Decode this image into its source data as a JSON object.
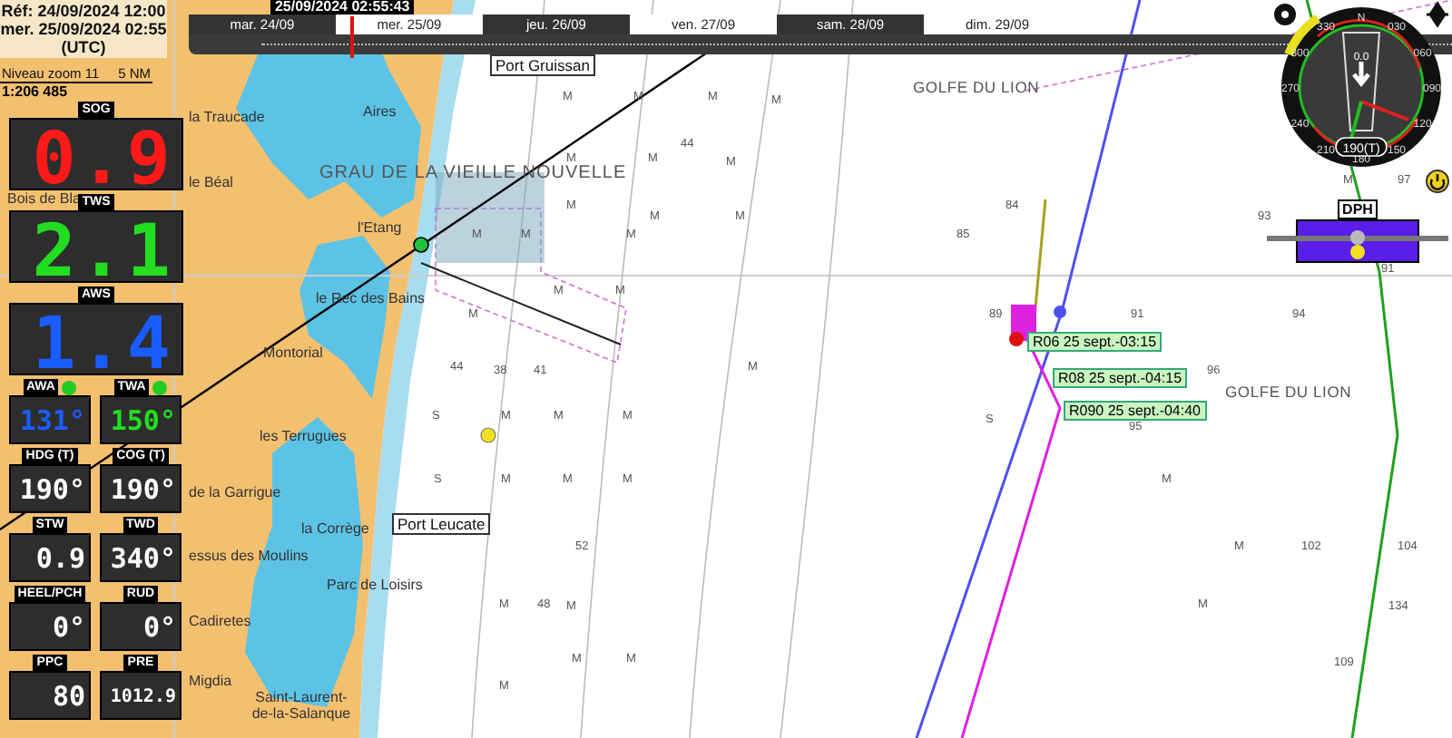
{
  "info": {
    "reference": "Réf: 24/09/2024 12:00",
    "current": "mer. 25/09/2024 02:55",
    "timezone": "(UTC)"
  },
  "scale": {
    "zoom_label": "Niveau zoom 11",
    "distance": "5 NM",
    "ratio": "1:206 485"
  },
  "timeline": {
    "cursor_label": "25/09/2024 02:55:43",
    "level": 0.13,
    "days": [
      "mar. 24/09",
      "mer. 25/09",
      "jeu. 26/09",
      "ven. 27/09",
      "sam. 28/09",
      "dim. 29/09"
    ]
  },
  "instruments": [
    {
      "kind": "large",
      "label": "SOG",
      "value": "0.9",
      "color": "#ff1a1a",
      "status_light": false
    },
    {
      "kind": "large",
      "label": "TWS",
      "value": "2.1",
      "color": "#22dd22",
      "status_light": false
    },
    {
      "kind": "large",
      "label": "AWS",
      "value": "1.4",
      "color": "#1a5cff",
      "status_light": false
    },
    {
      "kind": "small",
      "label": "AWA",
      "value": "131°",
      "color": "#1a5cff",
      "status_light": true
    },
    {
      "kind": "small",
      "label": "TWA",
      "value": "150°",
      "color": "#22dd22",
      "status_light": true
    },
    {
      "kind": "small",
      "label": "HDG (T)",
      "value": "190°",
      "color": "#ffffff",
      "status_light": false
    },
    {
      "kind": "small",
      "label": "COG (T)",
      "value": "190°",
      "color": "#ffffff",
      "status_light": false
    },
    {
      "kind": "small",
      "label": "STW",
      "value": "0.9",
      "color": "#ffffff",
      "status_light": false
    },
    {
      "kind": "small",
      "label": "TWD",
      "value": "340°",
      "color": "#ffffff",
      "status_light": false
    },
    {
      "kind": "small",
      "label": "HEEL/PCH",
      "value": "0°",
      "color": "#ffffff",
      "status_light": false
    },
    {
      "kind": "small",
      "label": "RUD",
      "value": "0°",
      "color": "#ffffff",
      "status_light": false
    },
    {
      "kind": "small",
      "label": "PPC",
      "value": "80",
      "color": "#ffffff",
      "status_light": false
    },
    {
      "kind": "small",
      "label": "PRE",
      "value": "1012.9",
      "color": "#ffffff",
      "status_light": false
    }
  ],
  "compass": {
    "labels": [
      "N",
      "030",
      "060",
      "090",
      "120",
      "150",
      "180",
      "210",
      "240",
      "270",
      "300",
      "330"
    ],
    "heading": "190(T)",
    "speed": "0.0"
  },
  "depth_gauge": {
    "label": "DPH"
  },
  "map": {
    "places": [
      {
        "kind": "port",
        "name": "Port Gruissan"
      },
      {
        "kind": "town",
        "name": "Aires"
      },
      {
        "kind": "town",
        "name": "la Traucade"
      },
      {
        "kind": "town",
        "name": "le Béal"
      },
      {
        "kind": "area",
        "name": "GRAU DE LA VIEILLE NOUVELLE"
      },
      {
        "kind": "town",
        "name": "l'Etang"
      },
      {
        "kind": "town",
        "name": "le Rec des Bains"
      },
      {
        "kind": "town",
        "name": "Montorial"
      },
      {
        "kind": "town",
        "name": "les Terrugues"
      },
      {
        "kind": "town",
        "name": "de la Garrigue"
      },
      {
        "kind": "town",
        "name": "la Corrège"
      },
      {
        "kind": "port",
        "name": "Port Leucate"
      },
      {
        "kind": "town",
        "name": "essus des Moulins"
      },
      {
        "kind": "town",
        "name": "Parc de Loisirs"
      },
      {
        "kind": "town",
        "name": "Cadiretes"
      },
      {
        "kind": "town",
        "name": "Migdia"
      },
      {
        "kind": "town",
        "name": "Saint-Laurent-de-la-Salanque"
      },
      {
        "kind": "sea",
        "name": "GOLFE DU LION"
      },
      {
        "kind": "sea",
        "name": "GOLFE DU LION"
      },
      {
        "kind": "town",
        "name": "Bois de Bla"
      }
    ],
    "soundings": [
      "M",
      "M",
      "M",
      "M",
      "44",
      "M",
      "M",
      "M",
      "M",
      "97",
      "M",
      "84",
      "M",
      "M",
      "93",
      "M",
      "M",
      "M",
      "85",
      "91",
      "M",
      "M",
      "M",
      "89",
      "91",
      "94",
      "44",
      "38",
      "41",
      "M",
      "96",
      "S",
      "M",
      "M",
      "M",
      "S",
      "95",
      "S",
      "M",
      "M",
      "M",
      "M",
      "52",
      "M",
      "102",
      "104",
      "M",
      "48",
      "M",
      "M",
      "134",
      "M",
      "M",
      "109",
      "M"
    ]
  },
  "waypoints": [
    "R06 25 sept.-03:15",
    "R08 25 sept.-04:15",
    "R090 25 sept.-04:40"
  ]
}
